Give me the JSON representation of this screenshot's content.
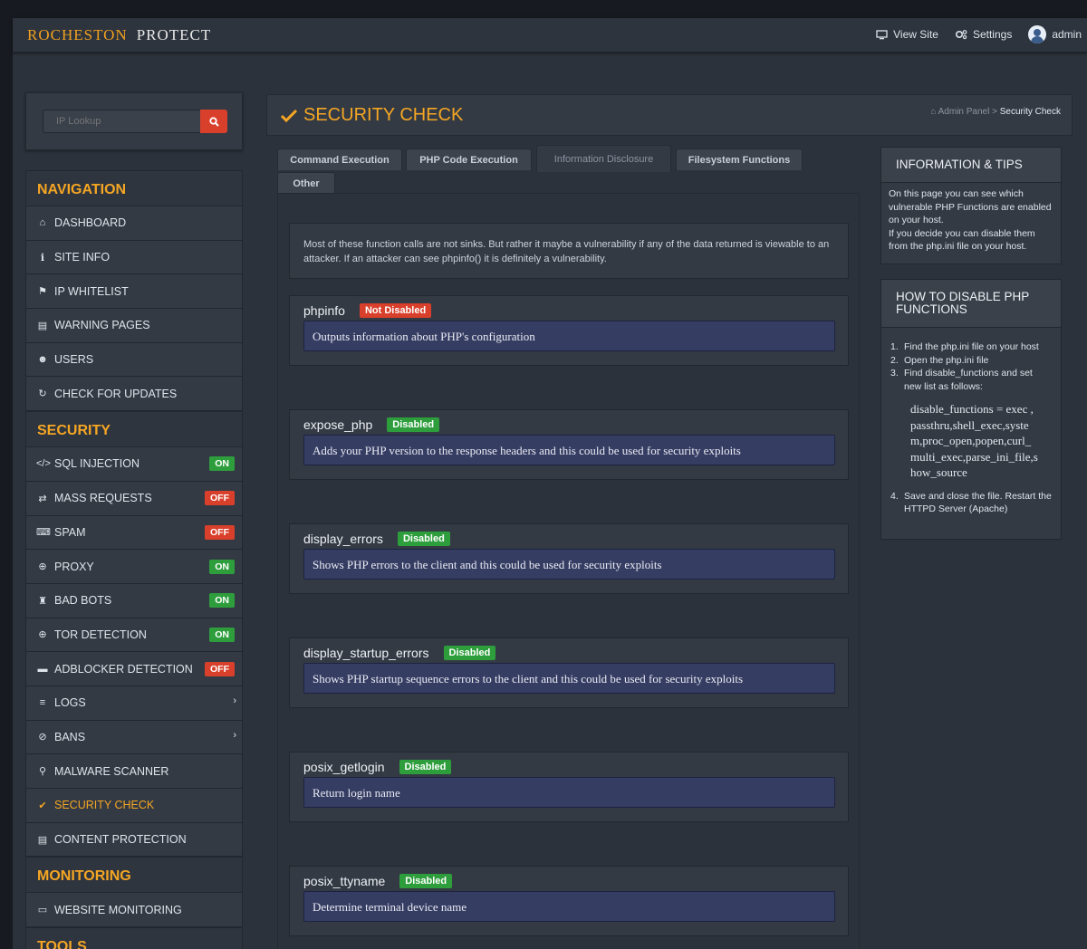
{
  "topbar": {
    "brand": "ROCHESTON",
    "product": "PROTECT",
    "view_site": "View Site",
    "settings": "Settings",
    "user": "admin"
  },
  "ip_lookup": {
    "placeholder": "IP Lookup"
  },
  "sidebar": {
    "navigation_title": "NAVIGATION",
    "navigation": [
      {
        "label": "DASHBOARD",
        "icon": "home-icon"
      },
      {
        "label": "SITE INFO",
        "icon": "info-icon"
      },
      {
        "label": "IP WHITELIST",
        "icon": "flag-icon"
      },
      {
        "label": "WARNING PAGES",
        "icon": "file-icon"
      },
      {
        "label": "USERS",
        "icon": "users-icon"
      },
      {
        "label": "CHECK FOR UPDATES",
        "icon": "refresh-icon"
      }
    ],
    "security_title": "SECURITY",
    "security": [
      {
        "label": "SQL INJECTION",
        "status": "ON",
        "icon": "code-icon"
      },
      {
        "label": "MASS REQUESTS",
        "status": "OFF",
        "icon": "retweet-icon"
      },
      {
        "label": "SPAM",
        "status": "OFF",
        "icon": "keyboard-icon"
      },
      {
        "label": "PROXY",
        "status": "ON",
        "icon": "globe-icon"
      },
      {
        "label": "BAD BOTS",
        "status": "ON",
        "icon": "user-secret-icon"
      },
      {
        "label": "TOR DETECTION",
        "status": "ON",
        "icon": "globe-icon"
      },
      {
        "label": "ADBLOCKER DETECTION",
        "status": "OFF",
        "icon": "window-icon"
      },
      {
        "label": "LOGS",
        "icon": "list-icon"
      },
      {
        "label": "BANS",
        "icon": "ban-icon"
      },
      {
        "label": "MALWARE SCANNER",
        "icon": "search-icon"
      },
      {
        "label": "SECURITY CHECK",
        "icon": "check-icon"
      },
      {
        "label": "CONTENT PROTECTION",
        "icon": "file-icon"
      }
    ],
    "monitoring_title": "MONITORING",
    "monitoring": [
      {
        "label": "WEBSITE MONITORING",
        "icon": "monitor-icon"
      }
    ],
    "tools_title": "TOOLS"
  },
  "page": {
    "title": "SECURITY CHECK",
    "breadcrumb_root": "Admin Panel",
    "breadcrumb_sep": ">",
    "breadcrumb_current": "Security Check"
  },
  "tabs": [
    "Command Execution",
    "PHP Code Execution",
    "Information Disclosure",
    "Filesystem Functions",
    "Other"
  ],
  "intro": "Most of these function calls are not sinks. But rather it maybe a vulnerability if any of the data returned is viewable to an attacker. If an attacker can see phpinfo() it is definitely a vulnerability.",
  "functions": [
    {
      "name": "phpinfo",
      "status": "Not Disabled",
      "desc": "Outputs information about PHP's configuration"
    },
    {
      "name": "expose_php",
      "status": "Disabled",
      "desc": "Adds your PHP version to the response headers and this could be used for security exploits"
    },
    {
      "name": "display_errors",
      "status": "Disabled",
      "desc": "Shows PHP errors to the client and this could be used for security exploits"
    },
    {
      "name": "display_startup_errors",
      "status": "Disabled",
      "desc": "Shows PHP startup sequence errors to the client and this could be used for security exploits"
    },
    {
      "name": "posix_getlogin",
      "status": "Disabled",
      "desc": "Return login name"
    },
    {
      "name": "posix_ttyname",
      "status": "Disabled",
      "desc": "Determine terminal device name"
    }
  ],
  "info_panel": {
    "title": "INFORMATION & TIPS",
    "line1": "On this page you can see which vulnerable PHP Functions are enabled on your host.",
    "line2": "If you decide you can disable them from the php.ini file on your host."
  },
  "howto_panel": {
    "title": "HOW TO DISABLE PHP FUNCTIONS",
    "step1": "Find the php.ini file on your host",
    "step2": "Open the php.ini file",
    "step3": "Find disable_functions and set new list as follows:",
    "code": "disable_functions = exec ,passthru,shell_exec,system,proc_open,popen,curl_multi_exec,parse_ini_file,show_source",
    "step4": "Save and close the file. Restart the HTTPD Server (Apache)"
  },
  "colors": {
    "accent": "#f5a623",
    "on": "#2e9e3d",
    "off": "#d9402c",
    "desc_bg": "#363d63"
  }
}
